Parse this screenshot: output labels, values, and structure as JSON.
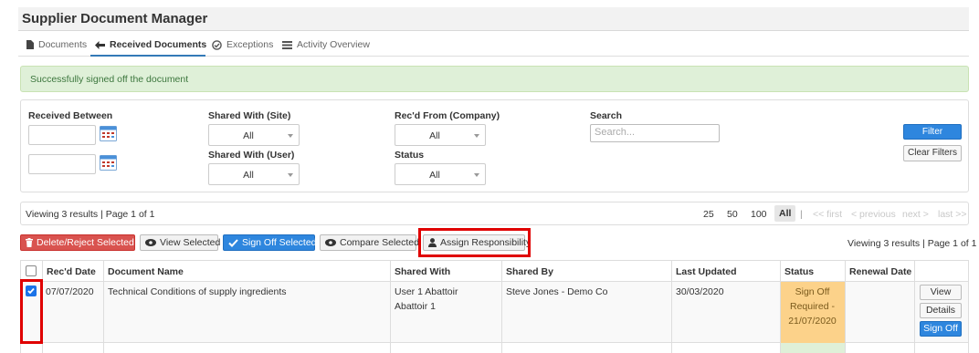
{
  "app": {
    "title": "Supplier Document Manager"
  },
  "tabs": [
    {
      "label": "Documents",
      "icon": "document-icon",
      "active": false
    },
    {
      "label": "Received Documents",
      "icon": "arrow-left-icon",
      "active": true
    },
    {
      "label": "Exceptions",
      "icon": "check-circle-icon",
      "active": false
    },
    {
      "label": "Activity Overview",
      "icon": "list-icon",
      "active": false
    }
  ],
  "alert": {
    "message": "Successfully signed off the document"
  },
  "filters": {
    "received_between": {
      "label": "Received Between",
      "from": "",
      "to": ""
    },
    "shared_with_site": {
      "label": "Shared With (Site)",
      "value": "All"
    },
    "shared_with_user": {
      "label": "Shared With (User)",
      "value": "All"
    },
    "recd_from_company": {
      "label": "Rec'd From (Company)",
      "value": "All"
    },
    "status": {
      "label": "Status",
      "value": "All"
    },
    "search": {
      "label": "Search",
      "placeholder": "Search...",
      "value": ""
    },
    "filter_button": "Filter",
    "clear_button": "Clear Filters"
  },
  "pager": {
    "viewing": "Viewing 3 results | Page 1 of 1",
    "sizes": [
      "25",
      "50",
      "100",
      "All"
    ],
    "selected_size": "All",
    "separator": "|",
    "first": "<< first",
    "previous": "< previous",
    "next": "next >",
    "last": "last >>"
  },
  "toolbar": {
    "delete": "Delete/Reject Selected",
    "view": "View Selected",
    "sign_off": "Sign Off Selected",
    "compare": "Compare Selected",
    "assign": "Assign Responsibility",
    "viewing": "Viewing 3 results | Page 1 of 1"
  },
  "table": {
    "columns": [
      "Rec'd Date",
      "Document Name",
      "Shared With",
      "Shared By",
      "Last Updated",
      "Status",
      "Renewal Date"
    ],
    "rows": [
      {
        "selected": true,
        "recd_date": "07/07/2020",
        "document_name": "Technical Conditions of supply ingredients",
        "shared_with": [
          "User 1 Abattoir",
          "Abattoir 1"
        ],
        "shared_by": "Steve Jones - Demo Co",
        "last_updated": "30/03/2020",
        "status": [
          "Sign Off",
          "Required -",
          "21/07/2020"
        ],
        "renewal_date": "",
        "actions": {
          "view": "View",
          "details": "Details",
          "sign_off": "Sign Off"
        }
      }
    ]
  },
  "colors": {
    "primary": "#2e86de",
    "danger": "#d9534f",
    "success_bg": "#dff0d8",
    "status_warning": "#fcd28a",
    "highlight": "#e00000"
  }
}
